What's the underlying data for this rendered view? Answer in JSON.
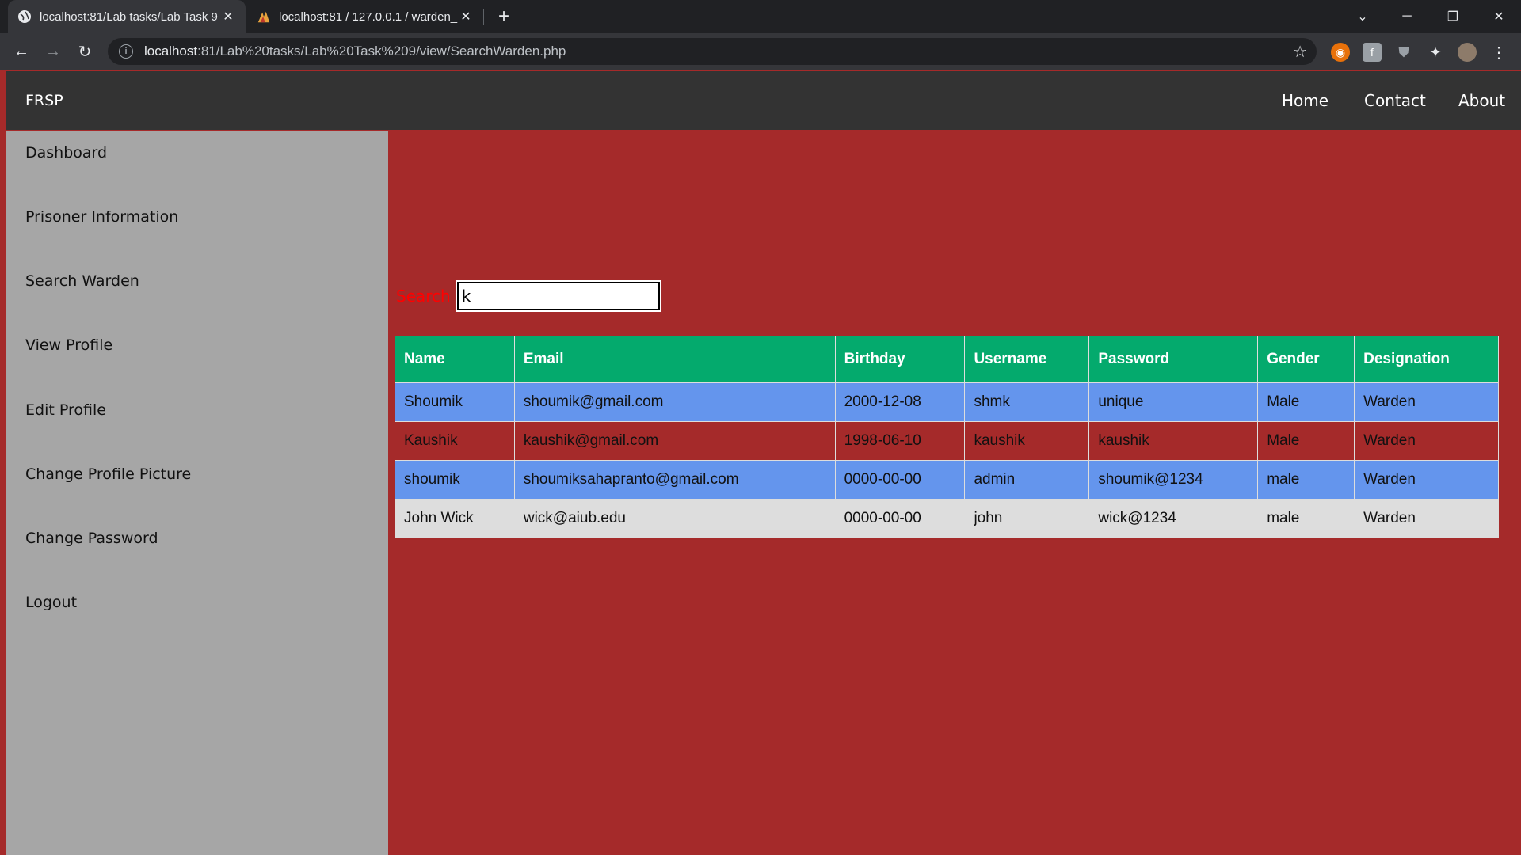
{
  "browser": {
    "tabs": [
      {
        "title": "localhost:81/Lab tasks/Lab Task 9",
        "active": true
      },
      {
        "title": "localhost:81 / 127.0.0.1 / warden_",
        "active": false
      }
    ],
    "url_host": "localhost",
    "url_rest": ":81/Lab%20tasks/Lab%20Task%209/view/SearchWarden.php"
  },
  "nav": {
    "brand": "FRSP",
    "links": [
      "Home",
      "Contact",
      "About"
    ]
  },
  "sidebar": {
    "items": [
      {
        "label": "Dashboard"
      },
      {
        "label": "Prisoner Information"
      },
      {
        "label": "Search Warden"
      },
      {
        "label": "View Profile"
      },
      {
        "label": "Edit Profile"
      },
      {
        "label": "Change Profile Picture"
      },
      {
        "label": "Change Password"
      },
      {
        "label": "Logout"
      }
    ]
  },
  "search": {
    "label": "Search",
    "value": "k"
  },
  "table": {
    "headers": [
      "Name",
      "Email",
      "Birthday",
      "Username",
      "Password",
      "Gender",
      "Designation"
    ],
    "rows": [
      [
        "Shoumik",
        "shoumik@gmail.com",
        "2000-12-08",
        "shmk",
        "unique",
        "Male",
        "Warden"
      ],
      [
        "Kaushik",
        "kaushik@gmail.com",
        "1998-06-10",
        "kaushik",
        "kaushik",
        "Male",
        "Warden"
      ],
      [
        "shoumik",
        "shoumiksahapranto@gmail.com",
        "0000-00-00",
        "admin",
        "shoumik@1234",
        "male",
        "Warden"
      ],
      [
        "John Wick",
        "wick@aiub.edu",
        "0000-00-00",
        "john",
        "wick@1234",
        "male",
        "Warden"
      ]
    ]
  },
  "colors": {
    "page_bg": "#a52a2a",
    "header_bg": "#04aa6d",
    "row_blue": "#6495ed",
    "row_gray": "#dddddd",
    "sidebar_bg": "#a6a6a6",
    "topnav_bg": "#333333"
  }
}
